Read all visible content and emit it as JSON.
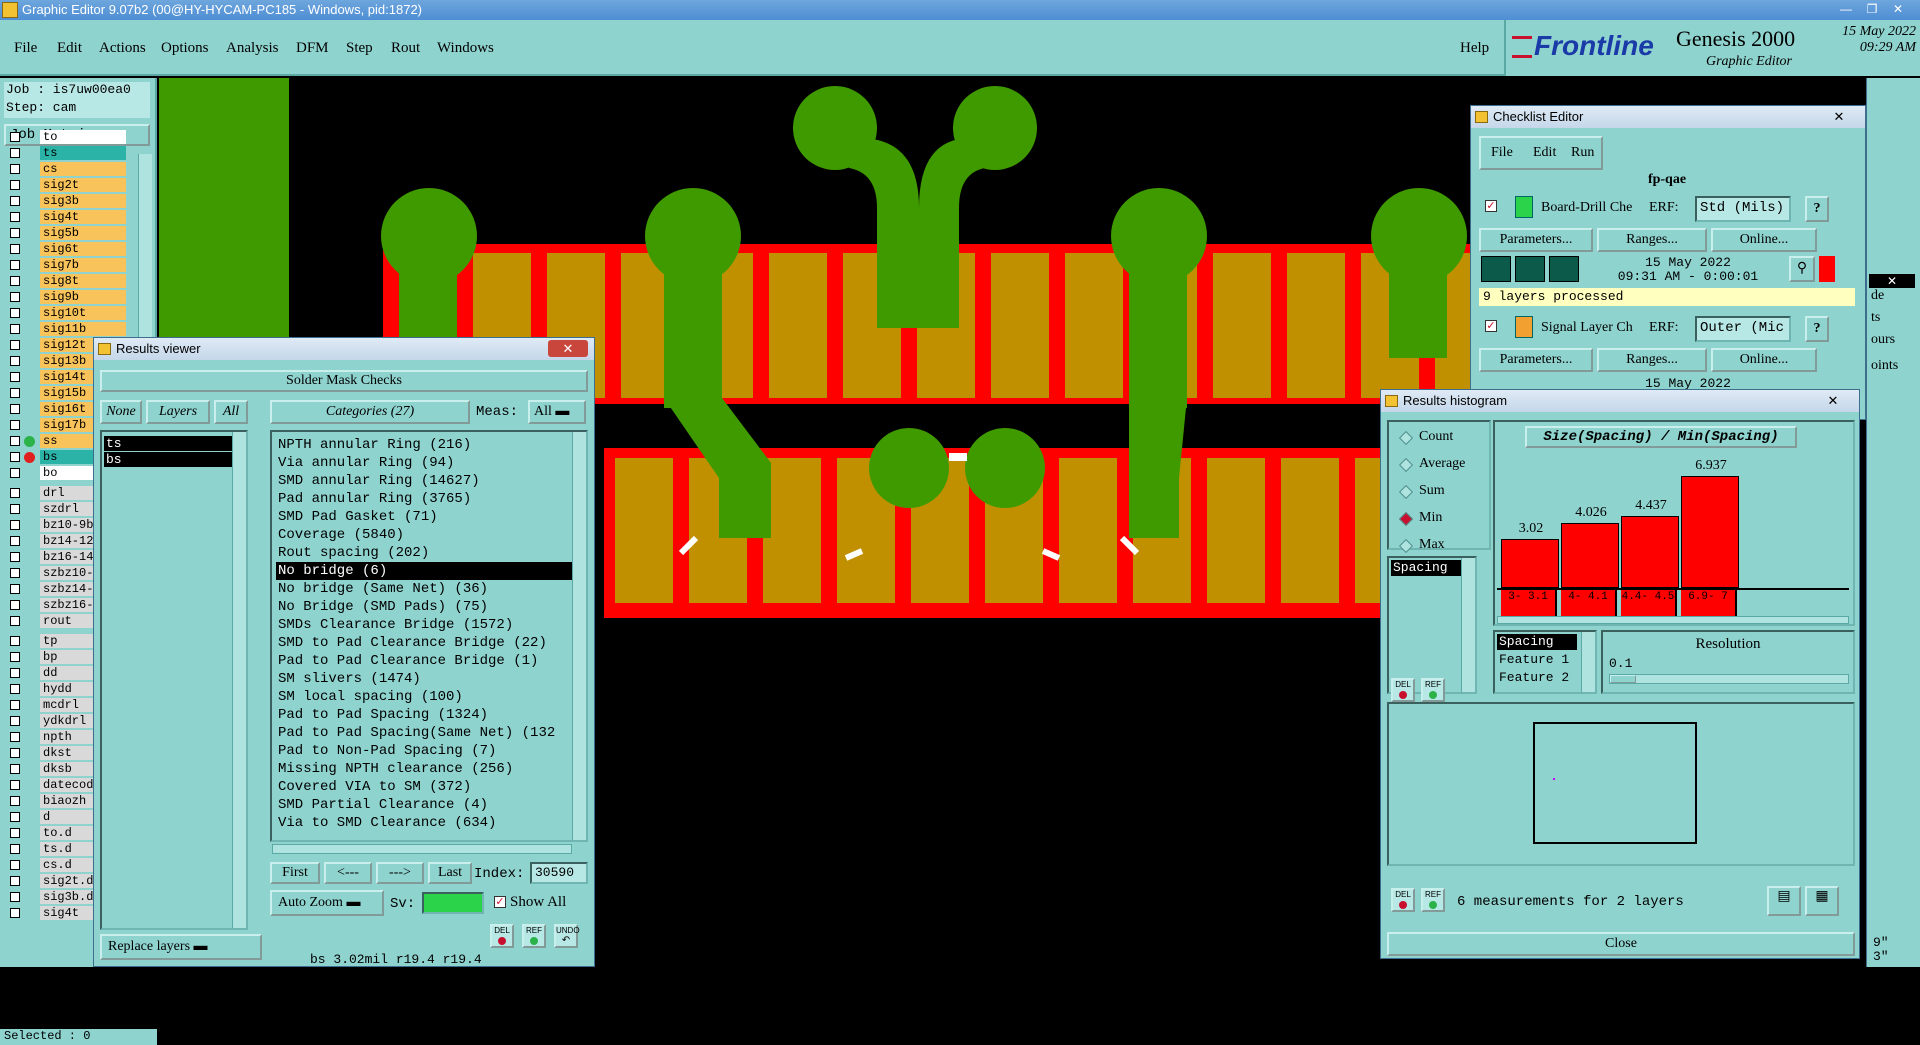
{
  "window": {
    "title": "Graphic Editor 9.07b2 (00@HY-HYCAM-PC185 - Windows, pid:1872)"
  },
  "menu": {
    "items": [
      "File",
      "Edit",
      "Actions",
      "Options",
      "Analysis",
      "DFM",
      "Step",
      "Rout",
      "Windows"
    ],
    "help": "Help"
  },
  "brand": {
    "logo": "Frontline",
    "product": "Genesis 2000",
    "subtitle": "Graphic Editor",
    "date": "15 May 2022",
    "time": "09:29 AM"
  },
  "left": {
    "job": "Job : is7uw00ea0",
    "step": "Step: cam",
    "job_matrix": "Job Matrix ...",
    "layers_board": [
      {
        "name": "to",
        "color": "#ffffff"
      },
      {
        "name": "ts",
        "color": "#2bb3a7"
      },
      {
        "name": "cs",
        "color": "#f7c35a"
      },
      {
        "name": "sig2t",
        "color": "#f7c35a"
      },
      {
        "name": "sig3b",
        "color": "#f7c35a"
      },
      {
        "name": "sig4t",
        "color": "#f7c35a"
      },
      {
        "name": "sig5b",
        "color": "#f7c35a"
      },
      {
        "name": "sig6t",
        "color": "#f7c35a"
      },
      {
        "name": "sig7b",
        "color": "#f7c35a"
      },
      {
        "name": "sig8t",
        "color": "#f7c35a"
      },
      {
        "name": "sig9b",
        "color": "#f7c35a"
      },
      {
        "name": "sig10t",
        "color": "#f7c35a"
      },
      {
        "name": "sig11b",
        "color": "#f7c35a"
      },
      {
        "name": "sig12t",
        "color": "#f7c35a"
      },
      {
        "name": "sig13b",
        "color": "#f7c35a"
      },
      {
        "name": "sig14t",
        "color": "#f7c35a"
      },
      {
        "name": "sig15b",
        "color": "#f7c35a"
      },
      {
        "name": "sig16t",
        "color": "#f7c35a"
      },
      {
        "name": "sig17b",
        "color": "#f7c35a"
      },
      {
        "name": "ss",
        "color": "#f7c35a"
      },
      {
        "name": "bs",
        "color": "#2bb3a7"
      },
      {
        "name": "bo",
        "color": "#ffffff"
      }
    ],
    "layers_drill": [
      "drl",
      "szdrl",
      "bz10-9b",
      "bz14-12",
      "bz16-14",
      "szbz10-",
      "szbz14-",
      "szbz16-",
      "rout"
    ],
    "layers_misc": [
      "tp",
      "bp",
      "dd",
      "hydd",
      "mcdrl",
      "ydkdrl",
      "npth",
      "dkst",
      "dksb",
      "datecod",
      "biaozh",
      "d",
      "to.d",
      "ts.d",
      "cs.d",
      "sig2t.d",
      "sig3b.d",
      "sig4t"
    ],
    "selected": "Selected : 0"
  },
  "results_viewer": {
    "title": "Results viewer",
    "header": "Solder Mask Checks",
    "none": "None",
    "layers": "Layers",
    "all": "All",
    "categories_btn": "Categories (27)",
    "meas_label": "Meas:",
    "meas_value": "All",
    "layer_list": [
      "ts",
      "bs"
    ],
    "categories": [
      "NPTH annular Ring (216)",
      "Via annular Ring (94)",
      "SMD annular Ring (14627)",
      "Pad annular Ring (3765)",
      "SMD Pad Gasket (71)",
      "Coverage (5840)",
      "Rout spacing (202)",
      "No bridge (6)",
      "No bridge (Same Net) (36)",
      "No Bridge (SMD Pads) (75)",
      "SMDs Clearance Bridge (1572)",
      "SMD to Pad Clearance Bridge (22)",
      "Pad to Pad Clearance Bridge (1)",
      "SM slivers (1474)",
      "SM local spacing (100)",
      "Pad to Pad Spacing (1324)",
      "Pad to Pad Spacing(Same Net) (132",
      "Pad to Non-Pad Spacing (7)",
      "Missing NPTH clearance (256)",
      "Covered VIA to SM (372)",
      "SMD Partial Clearance (4)",
      "Via to SMD Clearance (634)"
    ],
    "first": "First",
    "prev": "<---",
    "next": "--->",
    "last": "Last",
    "index_label": "Index:",
    "index_value": "30590",
    "auto_zoom": "Auto Zoom",
    "sv_label": "Sv:",
    "show_all": "Show All",
    "replace_layers": "Replace layers",
    "status": "bs 3.02mil  r19.4  r19.4",
    "del": "DEL",
    "ref": "REF",
    "undo": "UNDO"
  },
  "checklist": {
    "title": "Checklist Editor",
    "menu": [
      "File",
      "Edit",
      "Run"
    ],
    "name": "fp-qae",
    "check1": {
      "label": "Board-Drill Che",
      "erf": "ERF:",
      "erf_value": "Std (Mils)",
      "date": "15 May 2022",
      "time": "09:31 AM - 0:00:01",
      "status": "9 layers processed"
    },
    "check2": {
      "label": "Signal Layer Ch",
      "erf": "ERF:",
      "erf_value": "Outer (Mic",
      "date": "15 May 2022"
    },
    "parameters": "Parameters...",
    "ranges": "Ranges...",
    "online": "Online...",
    "help": "?"
  },
  "histogram": {
    "title": "Results histogram",
    "modes": [
      "Count",
      "Average",
      "Sum",
      "Min",
      "Max"
    ],
    "selected_mode": "Min",
    "chart_title": "Size(Spacing) / Min(Spacing)",
    "bars": [
      {
        "value": "3.02",
        "bin": "3- 3.1",
        "v": 3.02
      },
      {
        "value": "4.026",
        "bin": "4- 4.1",
        "v": 4.026
      },
      {
        "value": "4.437",
        "bin": "4.4- 4.5",
        "v": 4.437
      },
      {
        "value": "6.937",
        "bin": "6.9- 7",
        "v": 6.937
      }
    ],
    "measure_list": [
      "Spacing"
    ],
    "field_list": [
      "Spacing",
      "Feature 1",
      "Feature 2"
    ],
    "resolution_label": "Resolution",
    "resolution_value": "0.1",
    "summary": "6 measurements for 2 layers",
    "close": "Close",
    "del": "DEL",
    "ref": "REF"
  },
  "right_partial": {
    "items": [
      "de",
      "ts",
      "ours",
      "oints"
    ]
  },
  "bottom_right": {
    "line1": "9\"",
    "line2": "3\""
  }
}
